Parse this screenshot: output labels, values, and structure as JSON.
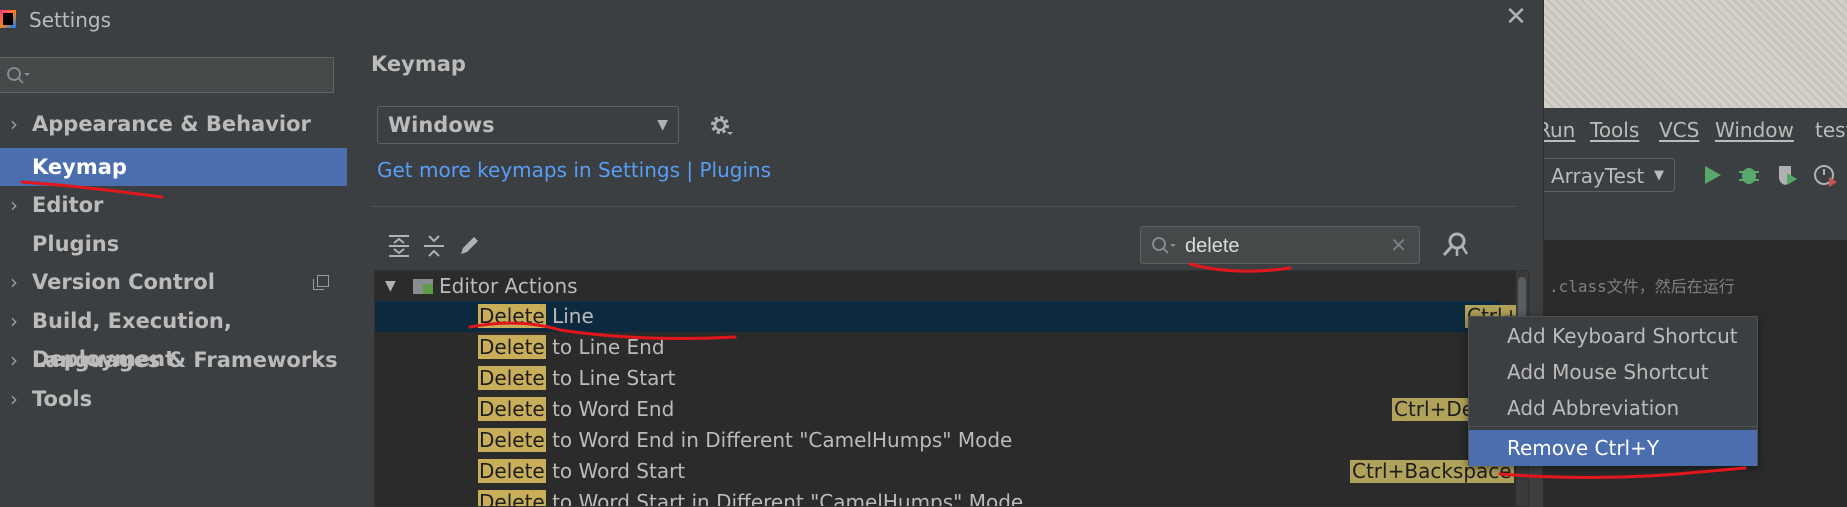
{
  "dialog": {
    "title": "Settings"
  },
  "sidebar": {
    "search_placeholder": "",
    "items": [
      {
        "label": "Appearance & Behavior"
      },
      {
        "label": "Keymap"
      },
      {
        "label": "Editor"
      },
      {
        "label": "Plugins"
      },
      {
        "label": "Version Control"
      },
      {
        "label": "Build, Execution, Deployment"
      },
      {
        "label": "Languages & Frameworks"
      },
      {
        "label": "Tools"
      }
    ]
  },
  "main": {
    "title": "Keymap",
    "keymap_value": "Windows",
    "more_keymaps_link": "Get more keymaps in Settings | Plugins",
    "search_value": "delete"
  },
  "tree": {
    "group": "Editor Actions",
    "rows": [
      {
        "match": "Delete",
        "rest": " Line",
        "shortcut": "Ctrl+Y"
      },
      {
        "match": "Delete",
        "rest": " to Line End",
        "shortcut": ""
      },
      {
        "match": "Delete",
        "rest": " to Line Start",
        "shortcut": ""
      },
      {
        "match": "Delete",
        "rest": " to Word End",
        "shortcut": "Ctrl+Del"
      },
      {
        "match": "Delete",
        "rest": " to Word End in Different \"CamelHumps\" Mode",
        "shortcut": ""
      },
      {
        "match": "Delete",
        "rest": " to Word Start",
        "shortcut": "Ctrl+Backspace"
      },
      {
        "match": "Delete",
        "rest": " to Word Start in Different \"CamelHumps\" Mode",
        "shortcut": ""
      }
    ]
  },
  "popup": {
    "items": [
      "Add Keyboard Shortcut",
      "Add Mouse Shortcut",
      "Add Abbreviation",
      "Remove Ctrl+Y"
    ]
  },
  "background_ide": {
    "menu": [
      "Run",
      "Tools",
      "VCS",
      "Window",
      "test"
    ],
    "run_config": "ArrayTest",
    "code_text": ".class文件，然后在运行"
  },
  "colors": {
    "selection": "#4b6eaf",
    "highlight": "#c9ae5a",
    "link": "#589df6",
    "annotation": "#e0171c"
  }
}
